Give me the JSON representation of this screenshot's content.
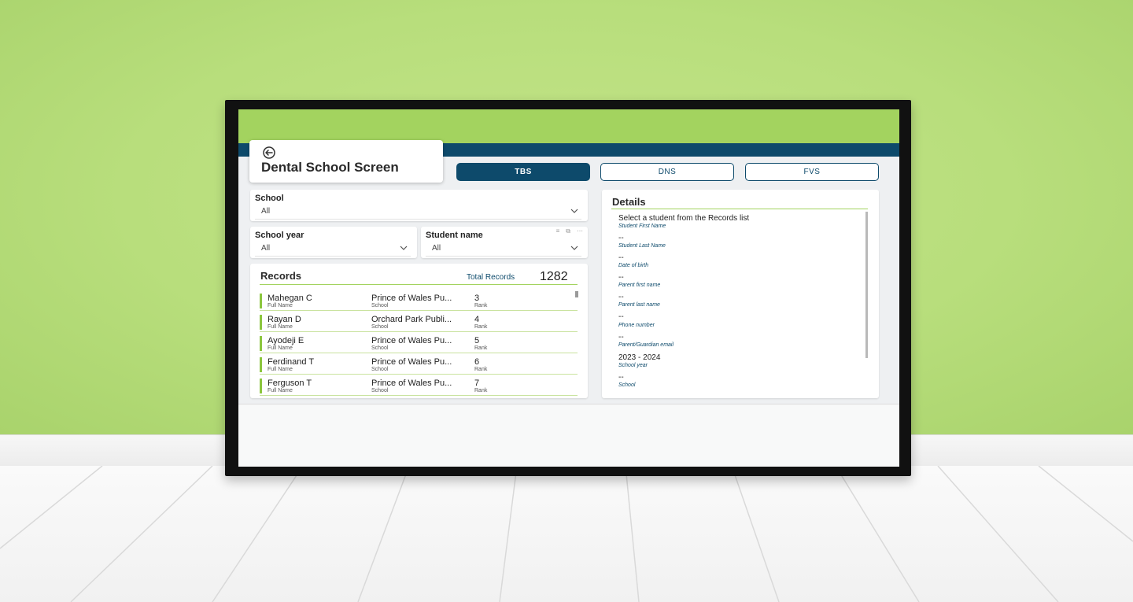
{
  "app": {
    "title": "Dental School Screen",
    "tabs": [
      {
        "label": "TBS",
        "active": true
      },
      {
        "label": "DNS",
        "active": false
      },
      {
        "label": "FVS",
        "active": false
      }
    ]
  },
  "filters": {
    "school": {
      "label": "School",
      "value": "All"
    },
    "school_year": {
      "label": "School year",
      "value": "All"
    },
    "student_name": {
      "label": "Student name",
      "value": "All"
    },
    "visual_tools": {
      "filter": "≡",
      "focus": "⧉",
      "more": "⋯"
    }
  },
  "records": {
    "title": "Records",
    "total_label": "Total Records",
    "total_value": "1282",
    "rows": [
      {
        "name": "Mahegan C",
        "name_label": "Full Name",
        "school": "Prince of Wales Pu...",
        "school_label": "School",
        "rank": "3",
        "rank_label": "Rank"
      },
      {
        "name": "Rayan D",
        "name_label": "Full Name",
        "school": "Orchard Park Publi...",
        "school_label": "School",
        "rank": "4",
        "rank_label": "Rank"
      },
      {
        "name": "Ayodeji E",
        "name_label": "Full Name",
        "school": "Prince of Wales Pu...",
        "school_label": "School",
        "rank": "5",
        "rank_label": "Rank"
      },
      {
        "name": "Ferdinand T",
        "name_label": "Full Name",
        "school": "Prince of Wales Pu...",
        "school_label": "School",
        "rank": "6",
        "rank_label": "Rank"
      },
      {
        "name": "Ferguson T",
        "name_label": "Full Name",
        "school": "Prince of Wales Pu...",
        "school_label": "School",
        "rank": "7",
        "rank_label": "Rank"
      }
    ]
  },
  "details": {
    "title": "Details",
    "fields": [
      {
        "value": "Select a student from the Records list",
        "label": "Student First Name"
      },
      {
        "value": "--",
        "label": "Student Last Name"
      },
      {
        "value": "--",
        "label": "Date of birth"
      },
      {
        "value": "--",
        "label": "Parent first name"
      },
      {
        "value": "--",
        "label": "Parent last name"
      },
      {
        "value": "--",
        "label": "Phone number"
      },
      {
        "value": "--",
        "label": "Parent/Guardian email"
      },
      {
        "value": "2023 - 2024",
        "label": "School year"
      },
      {
        "value": "--",
        "label": "School"
      }
    ]
  },
  "colors": {
    "brand_green": "#a3d35f",
    "brand_navy": "#0d4a6b",
    "row_accent": "#8cc63f",
    "wall": "#b8de7c"
  },
  "icons": {
    "back": "back-arrow-icon",
    "dropdown": "chevron-down-icon"
  }
}
